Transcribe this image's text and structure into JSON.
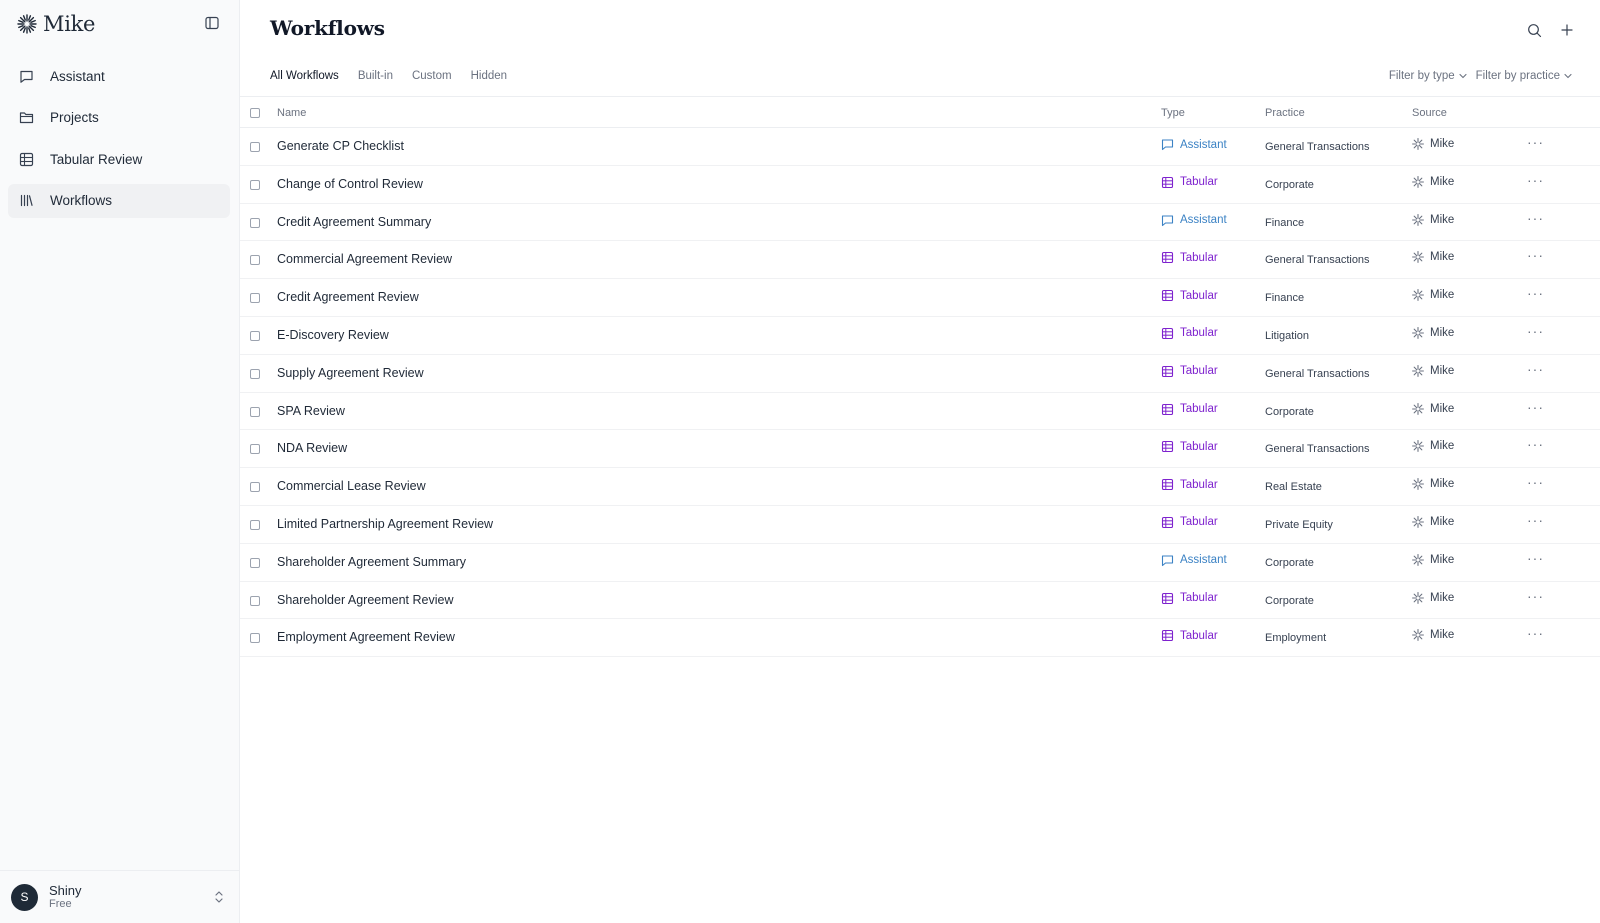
{
  "sidebar": {
    "brand": "Mike",
    "nav": [
      {
        "label": "Assistant",
        "icon": "chat-icon"
      },
      {
        "label": "Projects",
        "icon": "folder-icon"
      },
      {
        "label": "Tabular Review",
        "icon": "table-icon"
      },
      {
        "label": "Workflows",
        "icon": "library-icon"
      }
    ],
    "active_nav": "Workflows",
    "user": {
      "initial": "S",
      "name": "Shiny",
      "plan": "Free"
    }
  },
  "main": {
    "title": "Workflows",
    "tabs": [
      "All Workflows",
      "Built-in",
      "Custom",
      "Hidden"
    ],
    "active_tab": "All Workflows",
    "filters": [
      "Filter by type",
      "Filter by practice"
    ],
    "columns": {
      "name": "Name",
      "type": "Type",
      "practice": "Practice",
      "source": "Source"
    },
    "rows": [
      {
        "name": "Generate CP Checklist",
        "type": "Assistant",
        "practice": "General Transactions",
        "source": "Mike"
      },
      {
        "name": "Change of Control Review",
        "type": "Tabular",
        "practice": "Corporate",
        "source": "Mike"
      },
      {
        "name": "Credit Agreement Summary",
        "type": "Assistant",
        "practice": "Finance",
        "source": "Mike"
      },
      {
        "name": "Commercial Agreement Review",
        "type": "Tabular",
        "practice": "General Transactions",
        "source": "Mike"
      },
      {
        "name": "Credit Agreement Review",
        "type": "Tabular",
        "practice": "Finance",
        "source": "Mike"
      },
      {
        "name": "E-Discovery Review",
        "type": "Tabular",
        "practice": "Litigation",
        "source": "Mike"
      },
      {
        "name": "Supply Agreement Review",
        "type": "Tabular",
        "practice": "General Transactions",
        "source": "Mike"
      },
      {
        "name": "SPA Review",
        "type": "Tabular",
        "practice": "Corporate",
        "source": "Mike"
      },
      {
        "name": "NDA Review",
        "type": "Tabular",
        "practice": "General Transactions",
        "source": "Mike"
      },
      {
        "name": "Commercial Lease Review",
        "type": "Tabular",
        "practice": "Real Estate",
        "source": "Mike"
      },
      {
        "name": "Limited Partnership Agreement Review",
        "type": "Tabular",
        "practice": "Private Equity",
        "source": "Mike"
      },
      {
        "name": "Shareholder Agreement Summary",
        "type": "Assistant",
        "practice": "Corporate",
        "source": "Mike"
      },
      {
        "name": "Shareholder Agreement Review",
        "type": "Tabular",
        "practice": "Corporate",
        "source": "Mike"
      },
      {
        "name": "Employment Agreement Review",
        "type": "Tabular",
        "practice": "Employment",
        "source": "Mike"
      }
    ],
    "more_label": "···"
  },
  "colors": {
    "assistant": "#3b82c4",
    "tabular": "#7e22ce",
    "sidebar_bg": "#f9fafb",
    "active_nav_bg": "#f0f1f3"
  }
}
